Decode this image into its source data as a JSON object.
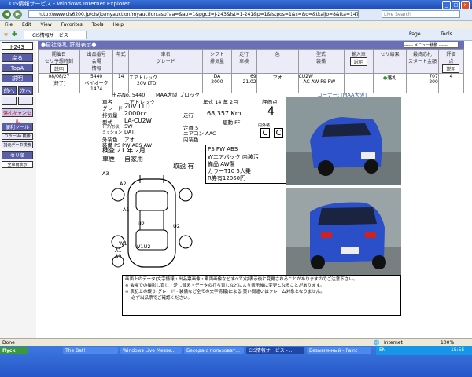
{
  "window": {
    "title": "CIS情報サービス - Windows Internet Explorer"
  },
  "address": {
    "url": "http://www.cis6200.jp/cis/jp/myauction/myauction.asp?aa=&ap=1&pgcd=J-243&lst=1-241&p=1&lstpos=1&s=&o=&tkaijo=8&tta=1474&tsyup=544",
    "search_placeholder": "Live Search"
  },
  "menu": [
    "File",
    "Edit",
    "View",
    "Favorites",
    "Tools",
    "Help"
  ],
  "tab": {
    "label": "CIS情報サービス"
  },
  "tools": {
    "page": "Page",
    "tools": "Tools"
  },
  "sidebar": {
    "code": "J-243",
    "back": "戻る",
    "top": "TopA",
    "help": "説明",
    "prev": "前へ",
    "next": "次へ",
    "lot_cancel": "落札キャンセル",
    "tools_label": "便利ツール",
    "color_search": "カラーNo.検索",
    "model_search": "諸元データ検索",
    "seri": "セリ順",
    "all_display": "全車両表示"
  },
  "header": {
    "title": "●自社落札 詳細表示●",
    "menu_select": "------ メニュー移動 ------"
  },
  "columns": {
    "date": "開催日\nセリ予想時刻",
    "date_btn": "説明",
    "lot": "出品番号\n会場\n情報",
    "year": "年式",
    "name": "車名\nグレード",
    "shift": "シフト\n排気量",
    "km": "走行\n車検",
    "color": "色",
    "model": "型式\n装備",
    "import": "輸入車",
    "import_btn": "説明",
    "result": "セリ結果",
    "price": "最終応札\nスタート金額",
    "rating": "評価\n点",
    "rating_btn": "説明"
  },
  "row": {
    "date": "08/08/27",
    "status": "[終了]",
    "lot": "5440",
    "venue": "ベイオーク",
    "info": "1474",
    "year": "14",
    "name": "エアトレック",
    "grade": "20V LTD",
    "shift": "DA",
    "cc": "2000",
    "km": "69",
    "inspection": "21.02",
    "color": "アオ",
    "model": "CU2W",
    "equip": "AC AW PS PW",
    "result": "落札",
    "price1": "707",
    "price2": "200",
    "rating": "4"
  },
  "sheet": {
    "lot_no": "出品No. 5440",
    "block": "MAA大阪 ブロック",
    "corner": "コーナー: [MAA大阪]",
    "car_name_label": "車名",
    "car_name": "エアトレック",
    "year_label": "年式 14 年 2月",
    "rating_label": "評価点",
    "rating": "4",
    "grade_label": "グレード",
    "grade": "20V LTD",
    "cc_label": "排気量",
    "cc": "2000cc",
    "km_label": "走行",
    "km": "68,357 Km",
    "model_label": "型式",
    "model": "LA-CU2W",
    "drive": "駆動 FF",
    "door_label": "ドア/形状",
    "door": "5W",
    "capacity": "定員 5",
    "mission_label": "ミッション",
    "mission": "DAT",
    "aircon": "エアコン AAC",
    "ext_color_label": "外装色",
    "ext_color": "アオ",
    "int_color": "内装色",
    "int_ext_label": "内外装",
    "grade_c1": "C",
    "grade_c2": "C",
    "equip": "装備 PS PW ABS AW",
    "inspection": "検査 21 年 2月",
    "history_label": "車歴",
    "history": "自家用",
    "manual": "取説 有",
    "notes": [
      "PS PW ABS",
      "Wエアバック 内装汚",
      "備品 AW傷",
      "カラーT10 5人乗",
      "R券有12060円"
    ],
    "damage_label": "A3",
    "marks": [
      "A2",
      "A1",
      "U2",
      "U2",
      "W1",
      "W1U2",
      "A1",
      "A2"
    ]
  },
  "note": {
    "lines": [
      "画面上のデータ(文字情報・出品票画像・車両画像などすべて)は表示後に変更されることがありますのでご注意下さい。",
      "※ 会場での撮影し直し・差し替え・データの打ち直しなどにより表示後に変更となることがあります。",
      "※ 表記上の誤り(グレード・装備など全ての文字情報)による 買い間違いはクレーム対象となりません。",
      "必ず出品票でご確認ください。"
    ]
  },
  "status": {
    "done": "Done",
    "zone": "Internet",
    "zoom": "100%"
  },
  "taskbar": {
    "start": "Пуск",
    "items": [
      "The Bat!",
      "Windows Live Messe...",
      "Беседа с пользоват...",
      "CIS情報サービス - ...",
      "Безымянный - Paint"
    ],
    "lang": "EN",
    "clock": "15:55"
  }
}
